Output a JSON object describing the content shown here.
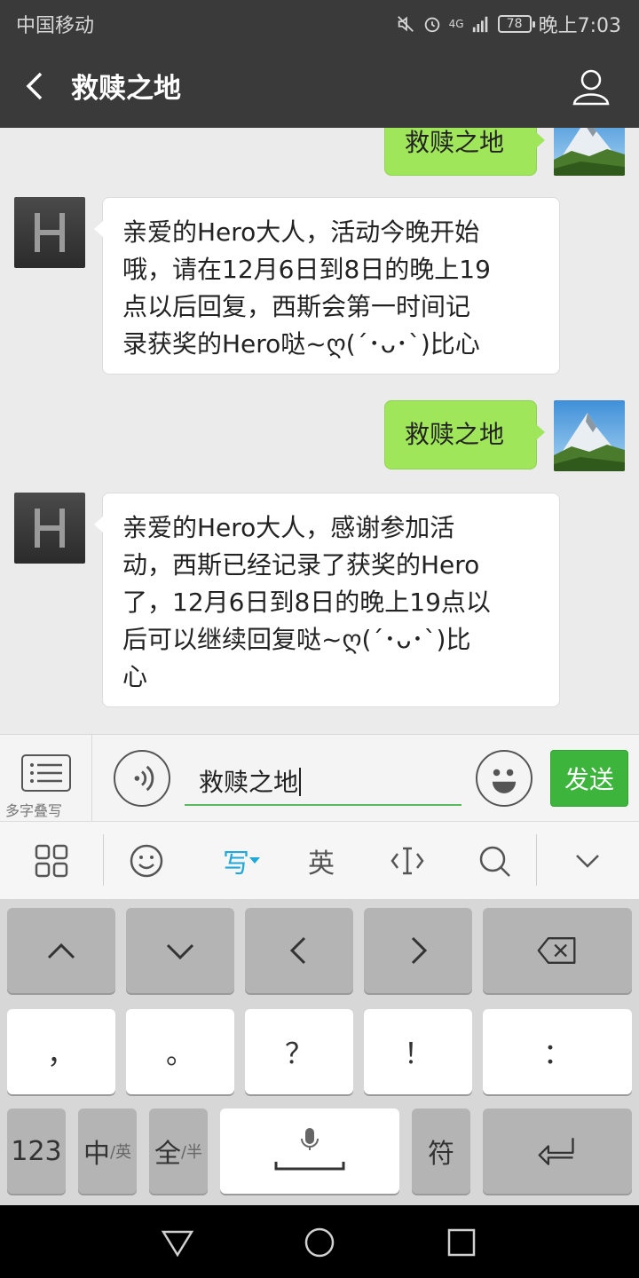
{
  "status_bar": {
    "carrier": "中国移动",
    "network": "4G",
    "battery": "78",
    "time": "晚上7:03"
  },
  "title_bar": {
    "title": "救赎之地"
  },
  "messages": [
    {
      "direction": "out",
      "text": "救赎之地"
    },
    {
      "direction": "in",
      "lines": [
        "亲爱的Hero大人，活动今晚开始",
        "哦，请在12月6日到8日的晚上19",
        "点以后回复，西斯会第一时间记",
        "录获奖的Hero哒~ღ(´･ᴗ･`)比心"
      ]
    },
    {
      "direction": "out",
      "text": "救赎之地"
    },
    {
      "direction": "in",
      "lines": [
        "亲爱的Hero大人，感谢参加活",
        "动，西斯已经记录了获奖的Hero",
        "了，12月6日到8日的晚上19点以",
        "后可以继续回复哒~ღ(´･ᴗ･`)比",
        "心"
      ]
    }
  ],
  "input_bar": {
    "multiword_label": "多字叠写",
    "input_value": "救赎之地",
    "send_label": "发送"
  },
  "keyboard_toolbar": {
    "write_label": "写",
    "english_label": "英"
  },
  "keyboard": {
    "row2": [
      "，",
      "。",
      "？",
      "！",
      "："
    ],
    "num_label": "123",
    "zh_main": "中",
    "zh_sub": "/英",
    "full_main": "全",
    "full_sub": "/半",
    "symbol_label": "符"
  },
  "colors": {
    "header_bg": "#3a3a3a",
    "send_green": "#3db53d",
    "outgoing_bubble": "#9fe65a",
    "accent_blue": "#1fa8d8"
  }
}
